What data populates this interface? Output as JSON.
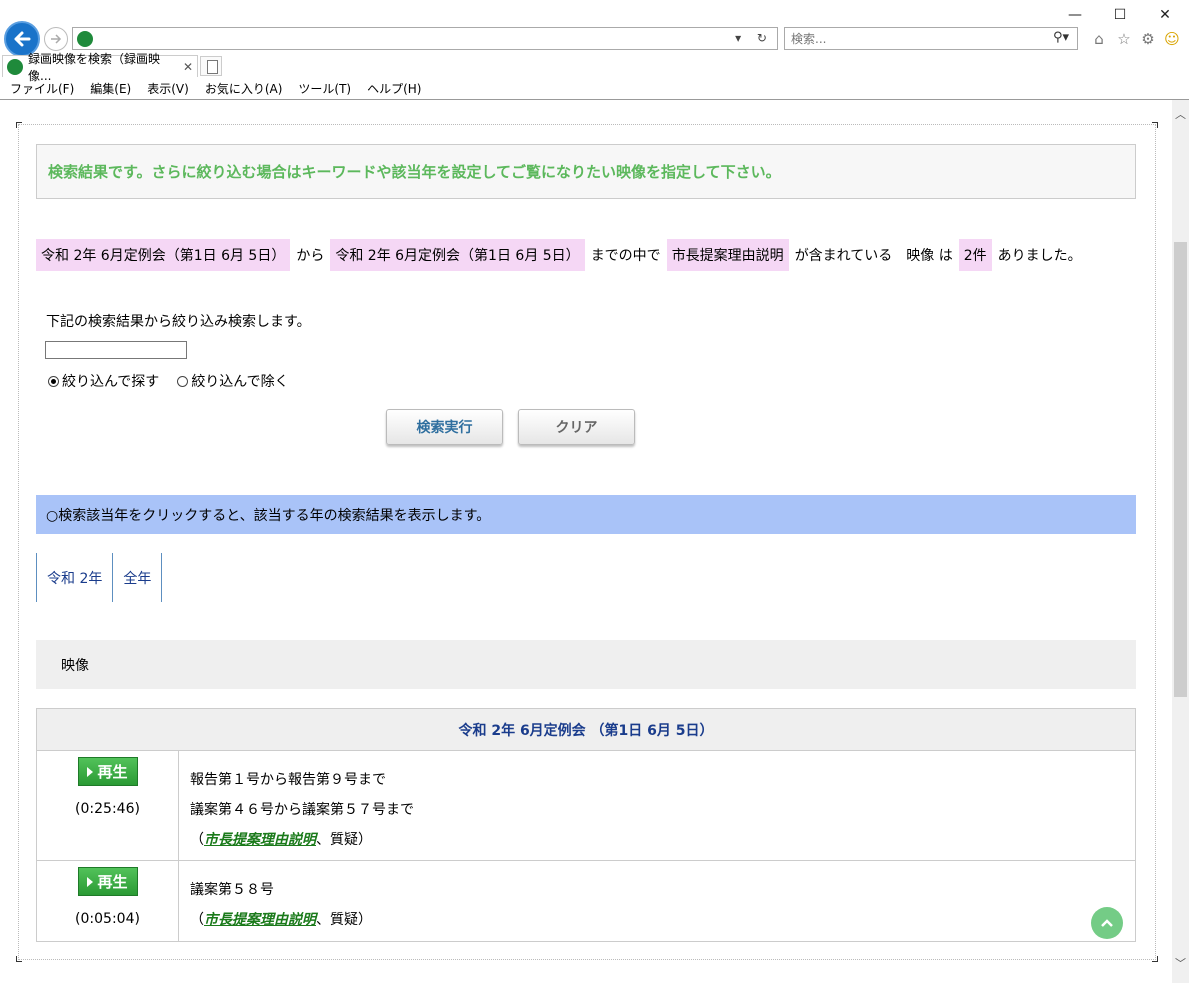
{
  "browser": {
    "tab_title": "録画映像を検索（録画映像...",
    "tab_close": "✕",
    "search_placeholder": "検索...",
    "menu": [
      "ファイル(F)",
      "編集(E)",
      "表示(V)",
      "お気に入り(A)",
      "ツール(T)",
      "ヘルプ(H)"
    ],
    "window_controls": {
      "minimize": "—",
      "maximize": "☐",
      "close": "✕"
    },
    "address_controls": "▾ ↻",
    "icons": [
      "home-icon",
      "star-icon",
      "gear-icon",
      "smiley-icon"
    ]
  },
  "notice": "検索結果です。さらに絞り込む場合はキーワードや該当年を設定してご覧になりたい映像を指定して下さい。",
  "summary": {
    "from": "令和 2年 6月定例会（第1日 6月 5日）",
    "from_suffix": "から",
    "to": "令和 2年 6月定例会（第1日 6月 5日）",
    "to_suffix": "までの中で",
    "keyword": "市長提案理由説明",
    "keyword_suffix": "が含まれている　映像 は",
    "count": "2件",
    "count_suffix": "ありました。"
  },
  "refine": {
    "label": "下記の検索結果から絞り込み検索します。",
    "input_value": "",
    "radio_include": "絞り込んで探す",
    "radio_exclude": "絞り込んで除く",
    "selected": "include",
    "search_button": "検索実行",
    "clear_button": "クリア"
  },
  "year_note": "○検索該当年をクリックすると、該当する年の検索結果を表示します。",
  "year_tabs": [
    "令和 2年",
    "全年"
  ],
  "section_title": "映像",
  "results": {
    "session_title": "令和 2年 6月定例会 （第1日 6月 5日）",
    "play_label": "再生",
    "rows": [
      {
        "duration": "(0:25:46)",
        "lines": [
          "報告第１号から報告第９号まで",
          "議案第４６号から議案第５７号まで"
        ],
        "note_open": "（",
        "link": "市長提案理由説明",
        "note_close": "、質疑）"
      },
      {
        "duration": "(0:05:04)",
        "lines": [
          "議案第５８号"
        ],
        "note_open": "（",
        "link": "市長提案理由説明",
        "note_close": "、質疑）"
      }
    ]
  },
  "colors": {
    "notice_text": "#5cb85c",
    "highlight": "#f5d7f5",
    "year_note_bg": "#a9c3f8",
    "link_green": "#1a7a1a",
    "heading_blue": "#1a3c8c",
    "back_button": "#1a73c9"
  }
}
